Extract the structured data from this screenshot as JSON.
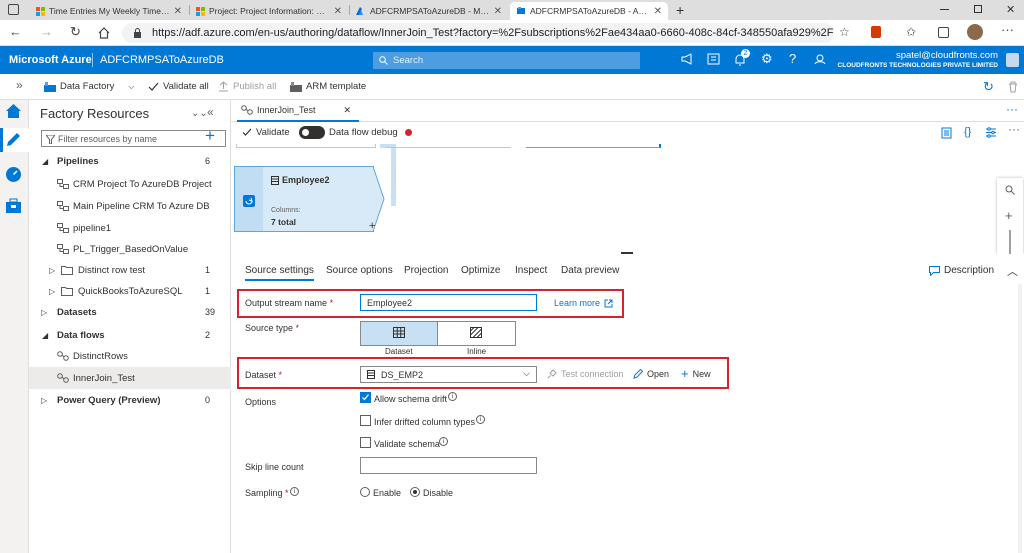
{
  "browser": {
    "tabs": [
      {
        "title": "Time Entries My Weekly Time En",
        "icon": "ms-logo-icon"
      },
      {
        "title": "Project: Project Information: BUG",
        "icon": "ms-logo-icon"
      },
      {
        "title": "ADFCRMPSAToAzureDB - Micros",
        "icon": "azure-icon"
      },
      {
        "title": "ADFCRMPSAToAzureDB - Azure",
        "icon": "adf-icon",
        "active": true
      }
    ],
    "new_tab": "+",
    "url": "https://adf.azure.com/en-us/authoring/dataflow/InnerJoin_Test?factory=%2Fsubscriptions%2Fae434aa0-6660-408c-84cf-348550afa929%2Fre..."
  },
  "azure": {
    "brand": "Microsoft Azure",
    "factory_name": "ADFCRMPSAToAzureDB",
    "search_placeholder": "Search",
    "notification_count": "2",
    "user_email": "spatel@cloudfronts.com",
    "user_org": "CLOUDFRONTS TECHNOLOGIES PRIVATE LIMITED"
  },
  "toolbar": {
    "data_factory": "Data Factory",
    "validate_all": "Validate all",
    "publish_all": "Publish all",
    "arm_template": "ARM template"
  },
  "resources": {
    "title": "Factory Resources",
    "filter_placeholder": "Filter resources by name",
    "pipelines_label": "Pipelines",
    "pipelines_count": "6",
    "pipelines": [
      "CRM Project To AzureDB Project",
      "Main Pipeline CRM To Azure DB",
      "pipeline1",
      "PL_Trigger_BasedOnValue"
    ],
    "folders": [
      {
        "name": "Distinct row test",
        "count": "1"
      },
      {
        "name": "QuickBooksToAzureSQL",
        "count": "1"
      }
    ],
    "datasets_label": "Datasets",
    "datasets_count": "39",
    "dataflows_label": "Data flows",
    "dataflows_count": "2",
    "dataflows": [
      "DistinctRows",
      "InnerJoin_Test"
    ],
    "powerquery_label": "Power Query (Preview)",
    "powerquery_count": "0"
  },
  "canvas": {
    "tab_title": "InnerJoin_Test",
    "validate": "Validate",
    "debug": "Data flow debug",
    "node_name": "Employee2",
    "node_columns_label": "Columns:",
    "node_columns_value": "7 total",
    "plus": "+"
  },
  "settings": {
    "tabs": [
      "Source settings",
      "Source options",
      "Projection",
      "Optimize",
      "Inspect",
      "Data preview"
    ],
    "description": "Description",
    "output_stream_label": "Output stream name",
    "required": "*",
    "output_stream_value": "Employee2",
    "learn_more": "Learn more",
    "source_type_label": "Source type",
    "source_dataset": "Dataset",
    "source_inline": "Inline",
    "dataset_label": "Dataset",
    "dataset_value": "DS_EMP2",
    "test_connection": "Test connection",
    "open": "Open",
    "new": "New",
    "options_label": "Options",
    "allow_schema_drift": "Allow schema drift",
    "infer_drifted": "Infer drifted column types",
    "validate_schema": "Validate schema",
    "skip_line_label": "Skip line count",
    "sampling_label": "Sampling",
    "sampling_enable": "Enable",
    "sampling_disable": "Disable"
  }
}
